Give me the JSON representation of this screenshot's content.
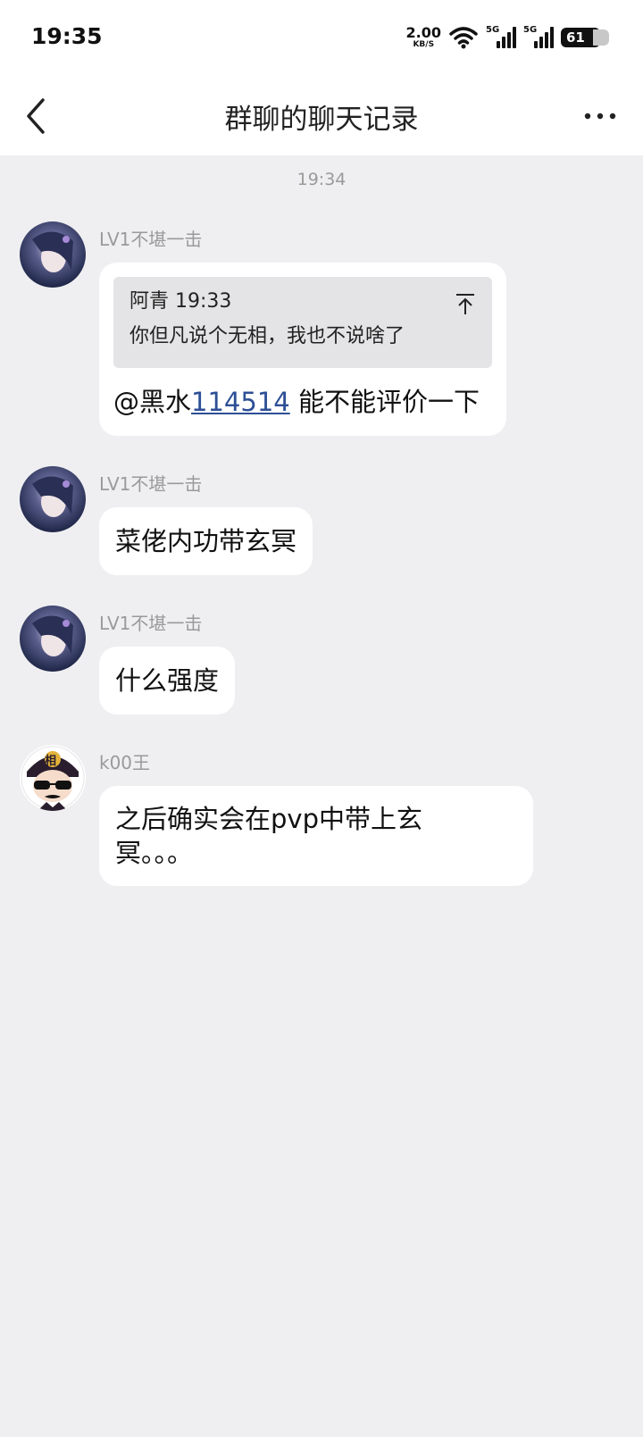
{
  "status_bar": {
    "time": "19:35",
    "net_speed": "2.00",
    "net_speed_unit": "KB/S",
    "signal1_label": "5G",
    "signal2_label": "5G",
    "battery": "61",
    "icons": [
      "wifi-icon",
      "signal-icon",
      "signal-icon",
      "battery-icon"
    ]
  },
  "nav": {
    "title": "群聊的聊天记录",
    "back_icon": "chevron-left-icon",
    "more_icon": "more-dots-icon"
  },
  "chat": {
    "time_separator": "19:34",
    "messages": [
      {
        "sender": "LV1不堪一击",
        "quote": {
          "author_time": "阿青 19:33",
          "text": "你但凡说个无相，我也不说啥了"
        },
        "mention_prefix": "@黑水",
        "mention_link": "114514",
        "text": " 能不能评价一下"
      },
      {
        "sender": "LV1不堪一击",
        "text": "菜佬内功带玄冥"
      },
      {
        "sender": "LV1不堪一击",
        "text": "什么强度"
      },
      {
        "sender": "k00王",
        "text_line1": "之后确实会在pvp中带上玄",
        "text_line2": "冥。。。",
        "avatar_badge": "相"
      }
    ]
  },
  "colors": {
    "background": "#efeff2",
    "bubble": "#ffffff",
    "quote_bg": "#e4e4e6",
    "link": "#2d4f96",
    "meta_text": "#9a9a9a"
  }
}
